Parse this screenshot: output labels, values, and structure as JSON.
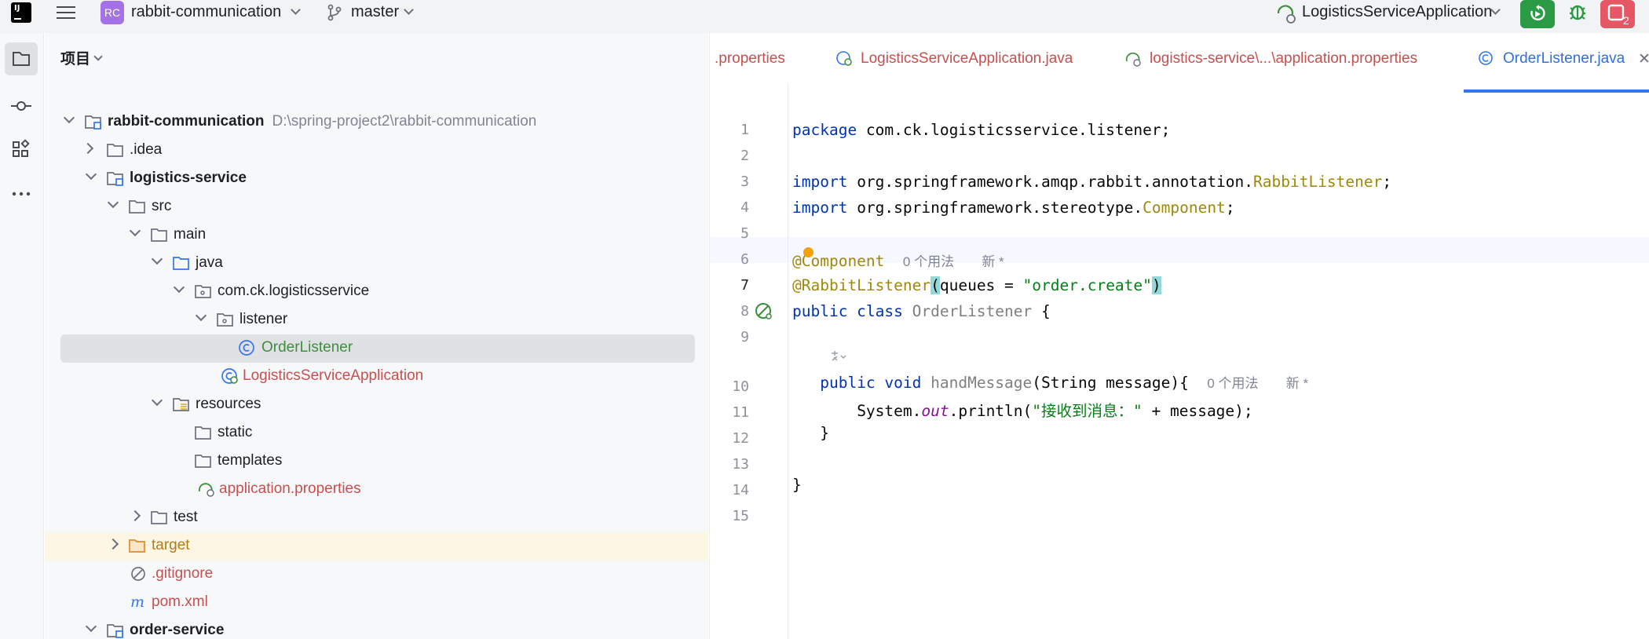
{
  "titlebar": {
    "project_badge": "RC",
    "project_name": "rabbit-communication",
    "branch": "master",
    "run_config": "LogisticsServiceApplication",
    "colors": {
      "run": "#2b9a45",
      "stop": "#e55765",
      "badge": "#a571e6"
    }
  },
  "project_panel": {
    "header": "项目",
    "tree": [
      {
        "label": "rabbit-communication",
        "path": "D:\\spring-project2\\rabbit-communication",
        "icon": "module-folder-icon"
      },
      {
        "label": ".idea",
        "icon": "folder-icon"
      },
      {
        "label": "logistics-service",
        "icon": "module-folder-icon"
      },
      {
        "label": "src",
        "icon": "folder-icon"
      },
      {
        "label": "main",
        "icon": "folder-icon"
      },
      {
        "label": "java",
        "icon": "source-folder-icon"
      },
      {
        "label": "com.ck.logisticsservice",
        "icon": "package-icon"
      },
      {
        "label": "listener",
        "icon": "package-icon"
      },
      {
        "label": "OrderListener",
        "icon": "class-icon"
      },
      {
        "label": "LogisticsServiceApplication",
        "icon": "spring-class-icon"
      },
      {
        "label": "resources",
        "icon": "resources-folder-icon"
      },
      {
        "label": "static",
        "icon": "folder-icon"
      },
      {
        "label": "templates",
        "icon": "folder-icon"
      },
      {
        "label": "application.properties",
        "icon": "spring-properties-icon"
      },
      {
        "label": "test",
        "icon": "folder-icon"
      },
      {
        "label": "target",
        "icon": "excluded-folder-icon"
      },
      {
        "label": ".gitignore",
        "icon": "ignore-file-icon"
      },
      {
        "label": "pom.xml",
        "icon": "maven-icon"
      },
      {
        "label": "order-service",
        "icon": "module-folder-icon"
      }
    ]
  },
  "editor": {
    "tabs": [
      {
        "label": ".properties"
      },
      {
        "label": "LogisticsServiceApplication.java"
      },
      {
        "label": "logistics-service\\...\\application.properties"
      },
      {
        "label": "OrderListener.java",
        "active": true
      }
    ],
    "line_numbers": [
      "1",
      "2",
      "3",
      "4",
      "5",
      "6",
      "7",
      "8",
      "9",
      "10",
      "11",
      "12",
      "13",
      "14",
      "15"
    ],
    "code": {
      "l1_kw": "package",
      "l1_rest": " com.ck.logisticsservice.listener;",
      "l3_kw": "import",
      "l3_rest": " org.springframework.amqp.rabbit.annotation.",
      "l3_cls": "RabbitListener",
      "l3_end": ";",
      "l4_kw": "import",
      "l4_rest": " org.springframework.stereotype.",
      "l4_cls": "Component",
      "l4_end": ";",
      "l6_ann": "@Component",
      "l6_hint_usages": "0 个用法",
      "l6_hint_new": "新 *",
      "l7_ann": "@RabbitListener",
      "l7_open": "(",
      "l7_mid": "queues = ",
      "l7_str": "\"order.create\"",
      "l7_close": ")",
      "l8_kw": "public class",
      "l8_name": " OrderListener",
      "l8_rest": " {",
      "l10_kw": "public void",
      "l10_name": " handMessage",
      "l10_rest": "(String message){",
      "l10_hint_usages": "0 个用法",
      "l10_hint_new": "新 *",
      "l11_a": "System.",
      "l11_field": "out",
      "l11_b": ".println(",
      "l11_str": "\"接收到消息：\"",
      "l11_c": " + message);",
      "l12": "}",
      "l14": "}"
    }
  }
}
